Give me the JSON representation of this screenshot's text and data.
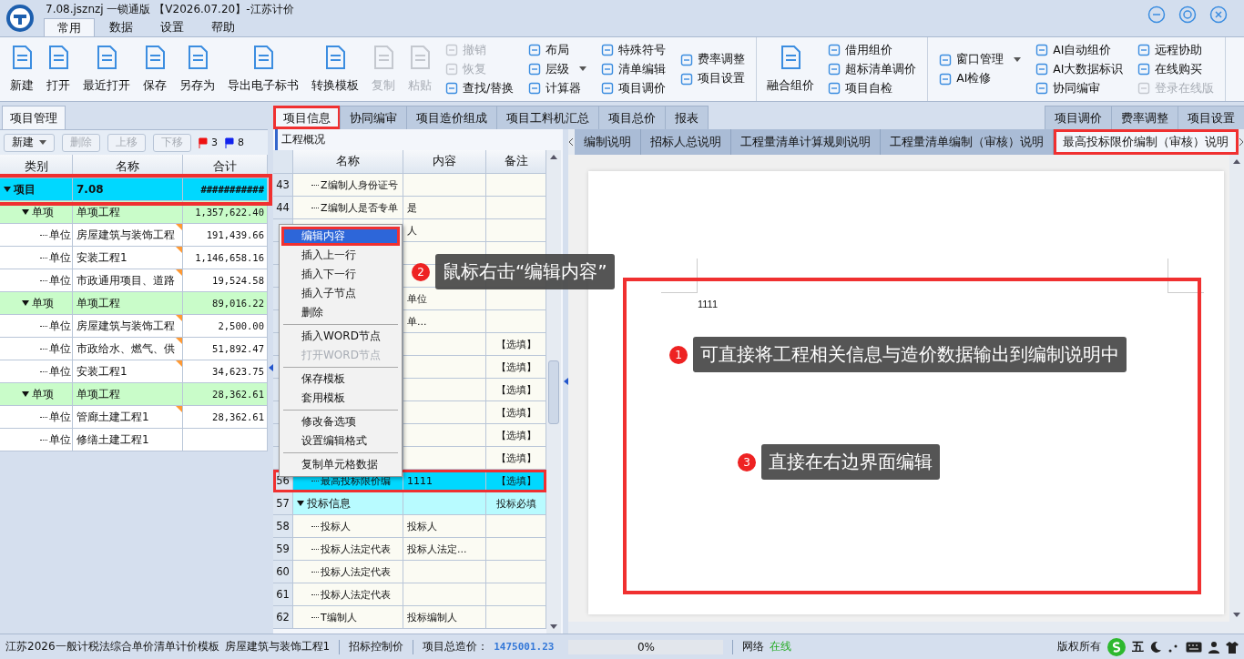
{
  "window": {
    "title": "7.08.jsznzj 一锁通版 【V2026.07.20】-江苏计价"
  },
  "menu_tabs": [
    {
      "label": "常用",
      "selected": true
    },
    {
      "label": "数据",
      "selected": false
    },
    {
      "label": "设置",
      "selected": false
    },
    {
      "label": "帮助",
      "selected": false
    }
  ],
  "ribbon": {
    "groups": [
      {
        "items": [
          {
            "kind": "large",
            "label": "新建",
            "disabled": false
          },
          {
            "kind": "large",
            "label": "打开",
            "disabled": false
          },
          {
            "kind": "large",
            "label": "最近打开",
            "disabled": false
          },
          {
            "kind": "large",
            "label": "保存",
            "disabled": false
          },
          {
            "kind": "large",
            "label": "另存为",
            "disabled": false
          },
          {
            "kind": "large",
            "label": "导出电子标书",
            "disabled": false
          },
          {
            "kind": "large",
            "label": "转换模板",
            "disabled": false
          },
          {
            "kind": "large",
            "label": "复制",
            "disabled": true
          },
          {
            "kind": "large",
            "label": "粘贴",
            "disabled": true
          },
          {
            "kind": "stack",
            "entries": [
              {
                "label": "撤销",
                "disabled": true,
                "dropdown": false
              },
              {
                "label": "恢复",
                "disabled": true,
                "dropdown": false
              },
              {
                "label": "查找/替换",
                "disabled": false,
                "dropdown": false
              }
            ]
          },
          {
            "kind": "stack",
            "entries": [
              {
                "label": "布局",
                "disabled": false,
                "dropdown": false
              },
              {
                "label": "层级",
                "disabled": false,
                "dropdown": true
              },
              {
                "label": "计算器",
                "disabled": false,
                "dropdown": false
              }
            ]
          },
          {
            "kind": "stack",
            "entries": [
              {
                "label": "特殊符号",
                "disabled": false,
                "dropdown": false
              },
              {
                "label": "清单编辑",
                "disabled": false,
                "dropdown": false
              },
              {
                "label": "项目调价",
                "disabled": false,
                "dropdown": false
              }
            ]
          },
          {
            "kind": "stack",
            "entries": [
              {
                "label": "费率调整",
                "disabled": false,
                "dropdown": false
              },
              {
                "label": "项目设置",
                "disabled": false,
                "dropdown": false
              }
            ]
          }
        ]
      },
      {
        "items": [
          {
            "kind": "large",
            "label": "融合组价",
            "disabled": false
          },
          {
            "kind": "stack",
            "entries": [
              {
                "label": "借用组价",
                "disabled": false,
                "dropdown": false
              },
              {
                "label": "超标清单调价",
                "disabled": false,
                "dropdown": false
              },
              {
                "label": "项目自检",
                "disabled": false,
                "dropdown": false
              }
            ]
          }
        ]
      },
      {
        "items": [
          {
            "kind": "stack",
            "entries": [
              {
                "label": "窗口管理",
                "disabled": false,
                "dropdown": true
              },
              {
                "label": "AI检修",
                "disabled": false,
                "dropdown": false
              }
            ]
          },
          {
            "kind": "stack",
            "entries": [
              {
                "label": "AI自动组价",
                "disabled": false,
                "dropdown": false
              },
              {
                "label": "AI大数据标识",
                "disabled": false,
                "dropdown": false
              },
              {
                "label": "协同编审",
                "disabled": false,
                "dropdown": false
              }
            ]
          },
          {
            "kind": "stack",
            "entries": [
              {
                "label": "远程协助",
                "disabled": false,
                "dropdown": false
              },
              {
                "label": "在线购买",
                "disabled": false,
                "dropdown": false
              },
              {
                "label": "登录在线版",
                "disabled": true,
                "dropdown": false
              }
            ]
          }
        ]
      }
    ]
  },
  "left_panel": {
    "tab": "项目管理",
    "toolbar": [
      {
        "label": "新建",
        "disabled": false,
        "dropdown": true
      },
      {
        "label": "删除",
        "disabled": true,
        "dropdown": false
      },
      {
        "label": "上移",
        "disabled": true,
        "dropdown": false
      },
      {
        "label": "下移",
        "disabled": true,
        "dropdown": false
      }
    ],
    "flags": [
      {
        "color": "#ee1111",
        "count": "3"
      },
      {
        "color": "#1122ee",
        "count": "8"
      }
    ],
    "columns": [
      "类别",
      "名称",
      "合计"
    ],
    "tree": [
      {
        "kind": "project",
        "type": "项目",
        "name": "7.08",
        "total": "###########",
        "expanded": true,
        "children": [
          {
            "kind": "item",
            "type": "单项",
            "name": "单项工程",
            "total": "1,357,622.40",
            "expanded": true,
            "children": [
              {
                "kind": "unit",
                "type": "单位",
                "name": "房屋建筑与装饰工程",
                "total": "191,439.66",
                "marked": true
              },
              {
                "kind": "unit",
                "type": "单位",
                "name": "安装工程1",
                "total": "1,146,658.16",
                "marked": true
              },
              {
                "kind": "unit",
                "type": "单位",
                "name": "市政通用项目、道路",
                "total": "19,524.58",
                "marked": true
              }
            ]
          },
          {
            "kind": "item",
            "type": "单项",
            "name": "单项工程",
            "total": "89,016.22",
            "expanded": true,
            "children": [
              {
                "kind": "unit",
                "type": "单位",
                "name": "房屋建筑与装饰工程",
                "total": "2,500.00",
                "marked": true
              },
              {
                "kind": "unit",
                "type": "单位",
                "name": "市政给水、燃气、供",
                "total": "51,892.47",
                "marked": true
              },
              {
                "kind": "unit",
                "type": "单位",
                "name": "安装工程1",
                "total": "34,623.75",
                "marked": true
              }
            ]
          },
          {
            "kind": "item",
            "type": "单项",
            "name": "单项工程",
            "total": "28,362.61",
            "expanded": true,
            "children": [
              {
                "kind": "unit",
                "type": "单位",
                "name": "管廊土建工程1",
                "total": "28,362.61",
                "marked": true
              },
              {
                "kind": "unit",
                "type": "单位",
                "name": "修缮土建工程1",
                "marked": false
              }
            ]
          }
        ]
      }
    ]
  },
  "tabs": [
    {
      "label": "项目信息",
      "selected": true
    },
    {
      "label": "协同编审",
      "selected": false
    },
    {
      "label": "项目造价组成",
      "selected": false
    },
    {
      "label": "项目工料机汇总",
      "selected": false
    },
    {
      "label": "项目总价",
      "selected": false
    },
    {
      "label": "报表",
      "selected": false
    }
  ],
  "right_tabs": [
    {
      "label": "项目调价",
      "selected": false
    },
    {
      "label": "费率调整",
      "selected": false
    },
    {
      "label": "项目设置",
      "selected": false
    }
  ],
  "info_panel": {
    "title": "工程概况",
    "columns": [
      "名称",
      "内容",
      "备注"
    ],
    "rows": [
      {
        "kind": "item",
        "number": "43",
        "name": "Z编制人身份证号",
        "selected": false
      },
      {
        "kind": "item",
        "number": "44",
        "name": "Z编制人是否专单",
        "content": "是",
        "selected": false
      },
      {
        "kind": "item",
        "content": "人",
        "selected": false
      },
      {
        "kind": "item",
        "selected": false
      },
      {
        "kind": "item",
        "selected": false
      },
      {
        "kind": "item",
        "content": "单位",
        "selected": false
      },
      {
        "kind": "item",
        "content": "单...",
        "selected": false
      },
      {
        "kind": "item",
        "note": "【选填】",
        "selected": false
      },
      {
        "kind": "item",
        "note": "【选填】",
        "selected": false
      },
      {
        "kind": "item",
        "note": "【选填】",
        "selected": false
      },
      {
        "kind": "item",
        "note": "【选填】",
        "selected": false
      },
      {
        "kind": "item",
        "note": "【选填】",
        "selected": false
      },
      {
        "kind": "item",
        "note": "【选填】",
        "selected": false
      },
      {
        "kind": "item",
        "number": "56",
        "name": "最高投标限价编",
        "content": "1111",
        "note": "【选填】",
        "selected": true
      },
      {
        "kind": "group",
        "number": "57",
        "name": "投标信息",
        "note": "投标必填",
        "selected": false
      },
      {
        "kind": "item",
        "number": "58",
        "name": "投标人",
        "content": "投标人",
        "selected": false
      },
      {
        "kind": "item",
        "number": "59",
        "name": "投标人法定代表",
        "content": "投标人法定...",
        "selected": false
      },
      {
        "kind": "item",
        "number": "60",
        "name": "投标人法定代表",
        "selected": false
      },
      {
        "kind": "item",
        "number": "61",
        "name": "投标人法定代表",
        "selected": false
      },
      {
        "kind": "item",
        "number": "62",
        "name": "T编制人",
        "content": "投标编制人",
        "selected": false
      }
    ]
  },
  "context_menu": [
    {
      "kind": "item",
      "label": "编辑内容",
      "selected": true,
      "disabled": false
    },
    {
      "kind": "item",
      "label": "插入上一行",
      "selected": false,
      "disabled": false
    },
    {
      "kind": "item",
      "label": "插入下一行",
      "selected": false,
      "disabled": false
    },
    {
      "kind": "item",
      "label": "插入子节点",
      "selected": false,
      "disabled": false
    },
    {
      "kind": "item",
      "label": "删除",
      "selected": false,
      "disabled": false
    },
    {
      "kind": "separator"
    },
    {
      "kind": "item",
      "label": "插入WORD节点",
      "selected": false,
      "disabled": false
    },
    {
      "kind": "item",
      "label": "打开WORD节点",
      "selected": false,
      "disabled": true
    },
    {
      "kind": "separator"
    },
    {
      "kind": "item",
      "label": "保存模板",
      "selected": false,
      "disabled": false
    },
    {
      "kind": "item",
      "label": "套用模板",
      "selected": false,
      "disabled": false
    },
    {
      "kind": "separator"
    },
    {
      "kind": "item",
      "label": "修改备选项",
      "selected": false,
      "disabled": false
    },
    {
      "kind": "item",
      "label": "设置编辑格式",
      "selected": false,
      "disabled": false
    },
    {
      "kind": "separator"
    },
    {
      "kind": "item",
      "label": "复制单元格数据",
      "selected": false,
      "disabled": false
    }
  ],
  "doc_tabs": [
    {
      "label": "编制说明",
      "selected": false
    },
    {
      "label": "招标人总说明",
      "selected": false
    },
    {
      "label": "工程量清单计算规则说明",
      "selected": false
    },
    {
      "label": "工程量清单编制（审核）说明",
      "selected": false
    },
    {
      "label": "最高投标限价编制（审核）说明",
      "selected": true
    }
  ],
  "document": {
    "text": "1111"
  },
  "callouts": [
    {
      "number": "1",
      "text": "可直接将工程相关信息与造价数据输出到编制说明中"
    },
    {
      "number": "2",
      "text": "鼠标右击“编辑内容”"
    },
    {
      "number": "3",
      "text": "直接在右边界面编辑"
    }
  ],
  "status_bar": {
    "template": "江苏2026一般计税法综合单价清单计价模板",
    "unit": "房屋建筑与装饰工程1",
    "mode": "招标控制价",
    "total_label": "项目总造价：",
    "total_value": "1475001.23",
    "progress": {
      "level": 0,
      "text": "0%"
    },
    "network_label": "网络",
    "network_status": "在线",
    "copyright": "版权所有",
    "ime": "五"
  }
}
